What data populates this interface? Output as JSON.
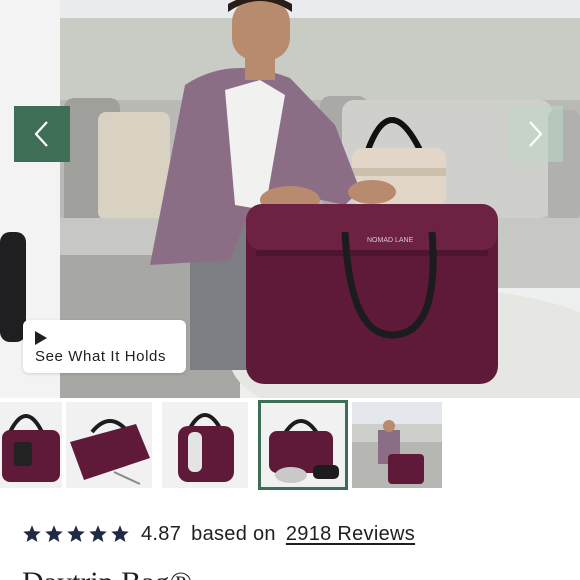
{
  "gallery": {
    "prev_label": "Previous image",
    "next_label": "Next image",
    "video_button_label": "See What It Holds"
  },
  "thumbnails": [
    {
      "name": "Bag side view with luggage tag",
      "active": false
    },
    {
      "name": "Bag top view opened",
      "active": false
    },
    {
      "name": "Bag with water bottle sleeve",
      "active": false
    },
    {
      "name": "Bag with accessory pouches",
      "active": true
    },
    {
      "name": "Lifestyle photo of man with bag",
      "active": false
    }
  ],
  "reviews": {
    "stars": 5,
    "rating": "4.87",
    "based_on": "based on",
    "reviews_link": "2918 Reviews"
  },
  "product": {
    "title_partial": "Daytrip Bag®"
  },
  "bag": {
    "brand_text": "NOMAD LANE"
  },
  "colors": {
    "accent": "#3f6e56",
    "bag": "#5e1a38",
    "star": "#1f2a44"
  }
}
